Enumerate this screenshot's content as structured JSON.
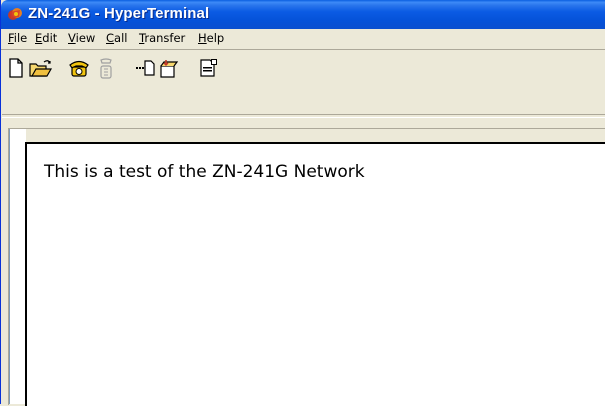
{
  "window": {
    "title": "ZN-241G - HyperTerminal"
  },
  "menu": {
    "items": [
      {
        "label": "File",
        "underline": "F",
        "rest": "ile"
      },
      {
        "label": "Edit",
        "underline": "E",
        "rest": "dit"
      },
      {
        "label": "View",
        "underline": "V",
        "rest": "iew"
      },
      {
        "label": "Call",
        "underline": "C",
        "rest": "all"
      },
      {
        "label": "Transfer",
        "underline": "T",
        "rest": "ransfer"
      },
      {
        "label": "Help",
        "underline": "H",
        "rest": "elp"
      }
    ]
  },
  "toolbar": {
    "buttons": [
      {
        "icon": "new-document-icon"
      },
      {
        "icon": "open-folder-icon"
      },
      {
        "icon": "call-icon"
      },
      {
        "icon": "disconnect-icon"
      },
      {
        "icon": "send-icon"
      },
      {
        "icon": "receive-icon"
      },
      {
        "icon": "properties-icon"
      }
    ]
  },
  "terminal": {
    "text": "This is a test of the ZN-241G Network"
  },
  "colors": {
    "titlebar": "#0552d9",
    "menubar": "#ece9d8",
    "terminal_bg": "#ffffff"
  }
}
